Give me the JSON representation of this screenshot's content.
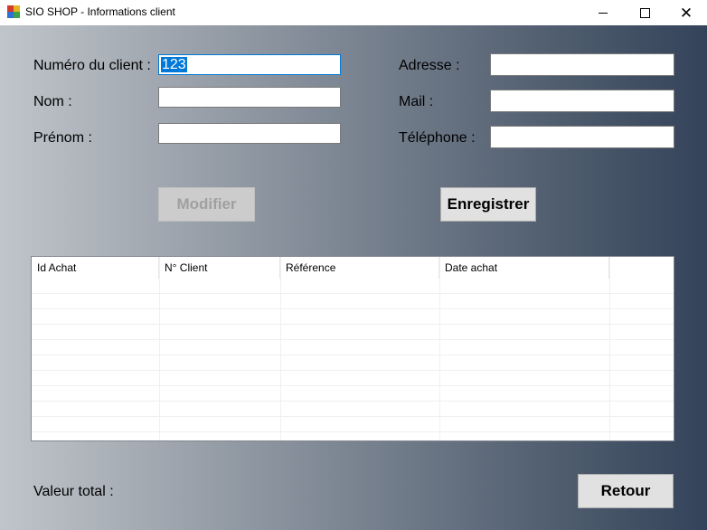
{
  "window": {
    "title": "SIO SHOP - Informations client",
    "minimize": "—",
    "close": "✕"
  },
  "form": {
    "client_number_label": "Numéro du client :",
    "client_number_value": "123",
    "nom_label": "Nom :",
    "nom_value": "",
    "prenom_label": "Prénom :",
    "prenom_value": "",
    "adresse_label": "Adresse :",
    "adresse_value": "",
    "mail_label": "Mail :",
    "mail_value": "",
    "telephone_label": "Téléphone :",
    "telephone_value": ""
  },
  "buttons": {
    "modifier": "Modifier",
    "enregistrer": "Enregistrer",
    "retour": "Retour"
  },
  "table": {
    "columns": [
      "Id Achat",
      "N° Client",
      "Référence",
      "Date achat"
    ],
    "rows": []
  },
  "footer": {
    "total_label": "Valeur total :"
  },
  "icons": {
    "app": "app-window-icon",
    "minimize": "minimize-icon",
    "maximize": "maximize-icon",
    "close": "close-icon"
  }
}
